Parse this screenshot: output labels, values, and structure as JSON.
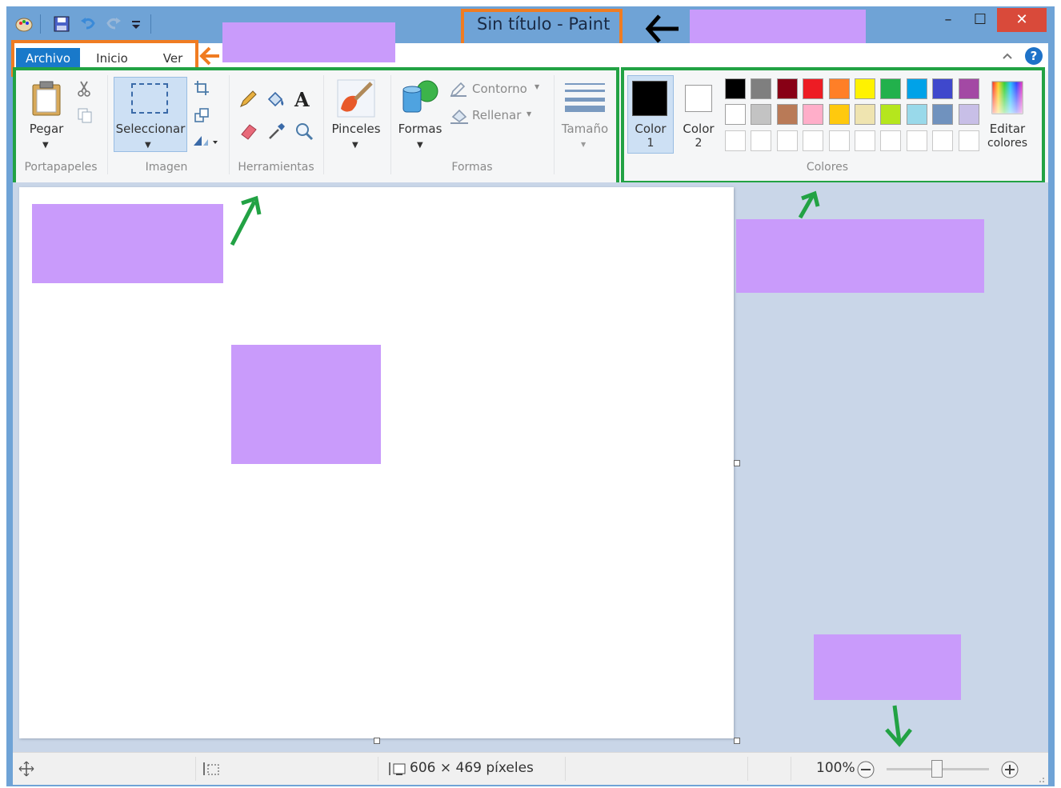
{
  "window": {
    "title": "Sin título - Paint",
    "minimize": "–",
    "maximize": "☐",
    "close": "✕"
  },
  "quick_access": {
    "app_icon": "paint-palette-icon",
    "save_icon": "save-icon",
    "undo_icon": "undo-icon",
    "redo_icon": "redo-icon",
    "customize_icon": "chevron-down-icon"
  },
  "tabs": [
    {
      "label": "Archivo"
    },
    {
      "label": "Inicio"
    },
    {
      "label": "Ver"
    }
  ],
  "ribbon": {
    "portapapeles": {
      "group_label": "Portapapeles",
      "paste_label": "Pegar"
    },
    "imagen": {
      "group_label": "Imagen",
      "select_label": "Seleccionar"
    },
    "herramientas": {
      "group_label": "Herramientas"
    },
    "pinceles": {
      "label": "Pinceles"
    },
    "formas": {
      "group_label": "Formas",
      "shapes_label": "Formas",
      "outline_label": "Contorno",
      "fill_label": "Rellenar"
    },
    "tamano": {
      "label": "Tamaño"
    },
    "colores": {
      "group_label": "Colores",
      "color1_label": "Color",
      "color1_num": "1",
      "color2_label": "Color",
      "color2_num": "2",
      "edit_label_1": "Editar",
      "edit_label_2": "colores",
      "color1_value": "#000000",
      "color2_value": "#ffffff",
      "palette_row1": [
        "#000000",
        "#7f7f7f",
        "#880015",
        "#ed1c24",
        "#ff7f27",
        "#fff200",
        "#22b14c",
        "#00a2e8",
        "#3f48cc",
        "#a349a4"
      ],
      "palette_row2": [
        "#ffffff",
        "#c3c3c3",
        "#b97a57",
        "#ffaec9",
        "#ffc90e",
        "#efe4b0",
        "#b5e61d",
        "#99d9ea",
        "#7092be",
        "#c8bfe7"
      ]
    }
  },
  "status": {
    "dimensions": "606 × 469 píxeles",
    "zoom": "100%"
  },
  "annotation_colors": {
    "orange": "#f07c22",
    "green": "#22a244",
    "purple": "#c99bfb"
  }
}
